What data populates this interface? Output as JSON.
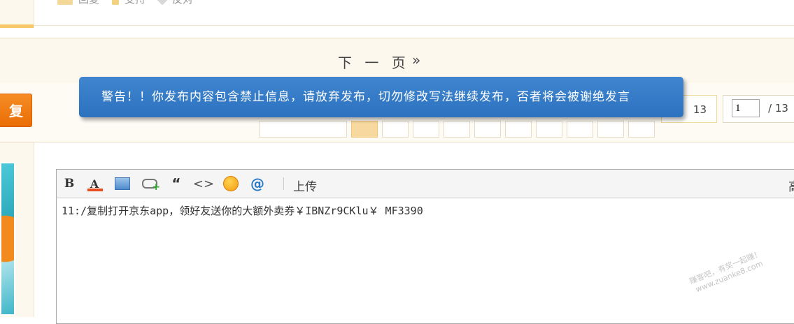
{
  "top_actions": [
    {
      "label": "回复",
      "icon": "reply-icon"
    },
    {
      "label": "支持",
      "icon": "support-icon"
    },
    {
      "label": "反对",
      "icon": "oppose-icon"
    }
  ],
  "next_page": {
    "label": "下 一 页",
    "arrow": "»"
  },
  "reply_button": {
    "label": "复"
  },
  "pager": {
    "total_pages": "13",
    "current_input": "1",
    "separator": "/ 13"
  },
  "warning": {
    "text": "警告！！你发布内容包含禁止信息，请放弃发布，切勿修改写法继续发布，否者将会被谢绝发言"
  },
  "editor": {
    "toolbar": {
      "bold": "B",
      "font_color": "A",
      "quote": "“",
      "code": "<>",
      "at": "@",
      "upload": "上传",
      "right_cut": "高"
    },
    "content": "11:/复制打开京东app，领好友送你的大额外卖券￥IBNZr9CKlu￥ MF3390"
  },
  "watermark": {
    "line1": "赚客吧，有奖一起赚！",
    "line2": "www.zuanke8.com"
  }
}
